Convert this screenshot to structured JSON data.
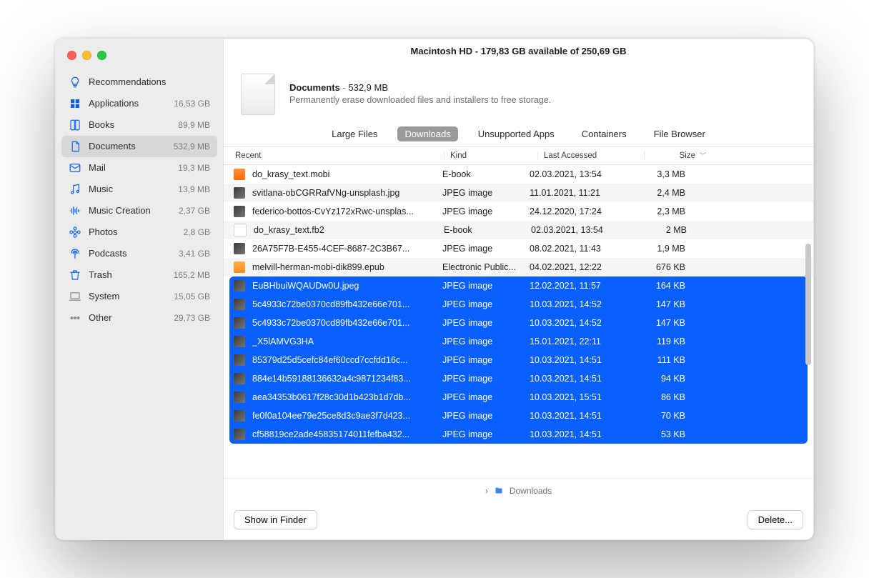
{
  "window_title": "Macintosh HD - 179,83 GB available of 250,69 GB",
  "sidebar": {
    "items": [
      {
        "label": "Recommendations",
        "value": "",
        "icon": "bulb"
      },
      {
        "label": "Applications",
        "value": "16,53 GB",
        "icon": "app"
      },
      {
        "label": "Books",
        "value": "89,9 MB",
        "icon": "book"
      },
      {
        "label": "Documents",
        "value": "532,9 MB",
        "icon": "doc"
      },
      {
        "label": "Mail",
        "value": "19,3 MB",
        "icon": "mail"
      },
      {
        "label": "Music",
        "value": "13,9 MB",
        "icon": "music"
      },
      {
        "label": "Music Creation",
        "value": "2,37 GB",
        "icon": "wave"
      },
      {
        "label": "Photos",
        "value": "2,8 GB",
        "icon": "flower"
      },
      {
        "label": "Podcasts",
        "value": "3,41 GB",
        "icon": "podcast"
      },
      {
        "label": "Trash",
        "value": "165,2 MB",
        "icon": "trash"
      },
      {
        "label": "System",
        "value": "15,05 GB",
        "icon": "laptop"
      },
      {
        "label": "Other",
        "value": "29,73 GB",
        "icon": "dots"
      }
    ],
    "active_index": 3
  },
  "summary": {
    "title": "Documents",
    "sep": " - ",
    "size": "532,9 MB",
    "desc": "Permanently erase downloaded files and installers to free storage."
  },
  "tabs": {
    "items": [
      "Large Files",
      "Downloads",
      "Unsupported Apps",
      "Containers",
      "File Browser"
    ],
    "active_index": 1
  },
  "columns": {
    "name": "Recent",
    "kind": "Kind",
    "date": "Last Accessed",
    "size": "Size"
  },
  "files": [
    {
      "name": "do_krasy_text.mobi",
      "kind": "E-book",
      "date": "02.03.2021, 13:54",
      "size": "3,3 MB",
      "thumb": "book",
      "selected": false
    },
    {
      "name": "svitlana-obCGRRafVNg-unsplash.jpg",
      "kind": "JPEG image",
      "date": "11.01.2021, 11:21",
      "size": "2,4 MB",
      "thumb": "img",
      "selected": false
    },
    {
      "name": "federico-bottos-CvYz172xRwc-unsplas...",
      "kind": "JPEG image",
      "date": "24.12.2020, 17:24",
      "size": "2,3 MB",
      "thumb": "img",
      "selected": false
    },
    {
      "name": "do_krasy_text.fb2",
      "kind": "E-book",
      "date": "02.03.2021, 13:54",
      "size": "2 MB",
      "thumb": "fb2",
      "selected": false
    },
    {
      "name": "26A75F7B-E455-4CEF-8687-2C3B67...",
      "kind": "JPEG image",
      "date": "08.02.2021, 11:43",
      "size": "1,9 MB",
      "thumb": "img",
      "selected": false
    },
    {
      "name": "melvill-herman-mobi-dik899.epub",
      "kind": "Electronic Public...",
      "date": "04.02.2021, 12:22",
      "size": "676 KB",
      "thumb": "epub",
      "selected": false
    },
    {
      "name": "EuBHbuiWQAUDw0U.jpeg",
      "kind": "JPEG image",
      "date": "12.02.2021, 11:57",
      "size": "164 KB",
      "thumb": "img",
      "selected": true
    },
    {
      "name": "5c4933c72be0370cd89fb432e66e701...",
      "kind": "JPEG image",
      "date": "10.03.2021, 14:52",
      "size": "147 KB",
      "thumb": "img",
      "selected": true
    },
    {
      "name": "5c4933c72be0370cd89fb432e66e701...",
      "kind": "JPEG image",
      "date": "10.03.2021, 14:52",
      "size": "147 KB",
      "thumb": "img",
      "selected": true
    },
    {
      "name": "_X5lAMVG3HA",
      "kind": "JPEG image",
      "date": "15.01.2021, 22:11",
      "size": "119 KB",
      "thumb": "img",
      "selected": true
    },
    {
      "name": "85379d25d5cefc84ef60ccd7ccfdd16c...",
      "kind": "JPEG image",
      "date": "10.03.2021, 14:51",
      "size": "111 KB",
      "thumb": "img",
      "selected": true
    },
    {
      "name": "884e14b59188136632a4c9871234f83...",
      "kind": "JPEG image",
      "date": "10.03.2021, 14:51",
      "size": "94 KB",
      "thumb": "img",
      "selected": true
    },
    {
      "name": "aea34353b0617f28c30d1b423b1d7db...",
      "kind": "JPEG image",
      "date": "10.03.2021, 15:51",
      "size": "86 KB",
      "thumb": "img",
      "selected": true
    },
    {
      "name": "fe0f0a104ee79e25ce8d3c9ae3f7d423...",
      "kind": "JPEG image",
      "date": "10.03.2021, 14:51",
      "size": "70 KB",
      "thumb": "img",
      "selected": true
    },
    {
      "name": "cf58819ce2ade45835174011fefba432...",
      "kind": "JPEG image",
      "date": "10.03.2021, 14:51",
      "size": "53 KB",
      "thumb": "img",
      "selected": true
    }
  ],
  "path": {
    "chevron": "›",
    "folder": "Downloads"
  },
  "footer": {
    "showInFinder": "Show in Finder",
    "delete": "Delete..."
  }
}
